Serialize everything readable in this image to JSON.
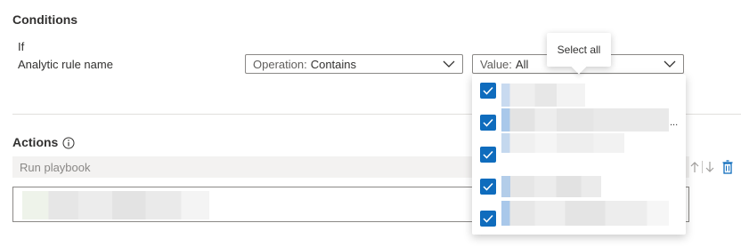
{
  "conditions": {
    "title": "Conditions",
    "if_label": "If",
    "field_label": "Analytic rule name",
    "operation": {
      "key": "Operation:",
      "value": "Contains"
    },
    "value": {
      "key": "Value:",
      "value": "All"
    }
  },
  "tooltip": {
    "text": "Select all"
  },
  "dropdown": {
    "options": [
      {
        "checked": true,
        "blur_widths": [
          188
        ],
        "truncated": false
      },
      {
        "checked": true,
        "blur_widths": [
          188
        ],
        "truncated": true
      },
      {
        "checked": true,
        "blur_widths": [
          138
        ],
        "truncated": false
      },
      {
        "checked": true,
        "blur_widths": [
          112
        ],
        "truncated": false
      },
      {
        "checked": true,
        "blur_widths": [
          188
        ],
        "truncated": false
      }
    ],
    "ellipsis": "..."
  },
  "actions": {
    "title": "Actions",
    "info_icon": "info-icon",
    "action_label": "Run playbook",
    "move_up_icon": "arrow-up-icon",
    "move_down_icon": "arrow-down-icon",
    "delete_icon": "trash-icon"
  },
  "colors": {
    "accent": "#0f6cbd",
    "border": "#8a8886",
    "disabled_bg": "#f3f2f1",
    "text": "#323130"
  }
}
